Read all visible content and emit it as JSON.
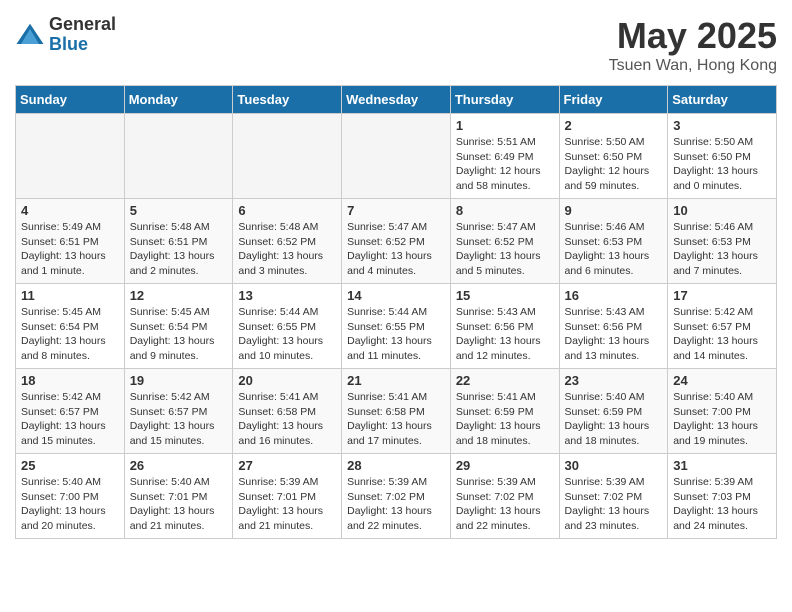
{
  "logo": {
    "general": "General",
    "blue": "Blue"
  },
  "title": {
    "month": "May 2025",
    "location": "Tsuen Wan, Hong Kong"
  },
  "weekdays": [
    "Sunday",
    "Monday",
    "Tuesday",
    "Wednesday",
    "Thursday",
    "Friday",
    "Saturday"
  ],
  "weeks": [
    [
      {
        "day": "",
        "info": ""
      },
      {
        "day": "",
        "info": ""
      },
      {
        "day": "",
        "info": ""
      },
      {
        "day": "",
        "info": ""
      },
      {
        "day": "1",
        "sunrise": "Sunrise: 5:51 AM",
        "sunset": "Sunset: 6:49 PM",
        "daylight": "Daylight: 12 hours and 58 minutes."
      },
      {
        "day": "2",
        "sunrise": "Sunrise: 5:50 AM",
        "sunset": "Sunset: 6:50 PM",
        "daylight": "Daylight: 12 hours and 59 minutes."
      },
      {
        "day": "3",
        "sunrise": "Sunrise: 5:50 AM",
        "sunset": "Sunset: 6:50 PM",
        "daylight": "Daylight: 13 hours and 0 minutes."
      }
    ],
    [
      {
        "day": "4",
        "sunrise": "Sunrise: 5:49 AM",
        "sunset": "Sunset: 6:51 PM",
        "daylight": "Daylight: 13 hours and 1 minute."
      },
      {
        "day": "5",
        "sunrise": "Sunrise: 5:48 AM",
        "sunset": "Sunset: 6:51 PM",
        "daylight": "Daylight: 13 hours and 2 minutes."
      },
      {
        "day": "6",
        "sunrise": "Sunrise: 5:48 AM",
        "sunset": "Sunset: 6:52 PM",
        "daylight": "Daylight: 13 hours and 3 minutes."
      },
      {
        "day": "7",
        "sunrise": "Sunrise: 5:47 AM",
        "sunset": "Sunset: 6:52 PM",
        "daylight": "Daylight: 13 hours and 4 minutes."
      },
      {
        "day": "8",
        "sunrise": "Sunrise: 5:47 AM",
        "sunset": "Sunset: 6:52 PM",
        "daylight": "Daylight: 13 hours and 5 minutes."
      },
      {
        "day": "9",
        "sunrise": "Sunrise: 5:46 AM",
        "sunset": "Sunset: 6:53 PM",
        "daylight": "Daylight: 13 hours and 6 minutes."
      },
      {
        "day": "10",
        "sunrise": "Sunrise: 5:46 AM",
        "sunset": "Sunset: 6:53 PM",
        "daylight": "Daylight: 13 hours and 7 minutes."
      }
    ],
    [
      {
        "day": "11",
        "sunrise": "Sunrise: 5:45 AM",
        "sunset": "Sunset: 6:54 PM",
        "daylight": "Daylight: 13 hours and 8 minutes."
      },
      {
        "day": "12",
        "sunrise": "Sunrise: 5:45 AM",
        "sunset": "Sunset: 6:54 PM",
        "daylight": "Daylight: 13 hours and 9 minutes."
      },
      {
        "day": "13",
        "sunrise": "Sunrise: 5:44 AM",
        "sunset": "Sunset: 6:55 PM",
        "daylight": "Daylight: 13 hours and 10 minutes."
      },
      {
        "day": "14",
        "sunrise": "Sunrise: 5:44 AM",
        "sunset": "Sunset: 6:55 PM",
        "daylight": "Daylight: 13 hours and 11 minutes."
      },
      {
        "day": "15",
        "sunrise": "Sunrise: 5:43 AM",
        "sunset": "Sunset: 6:56 PM",
        "daylight": "Daylight: 13 hours and 12 minutes."
      },
      {
        "day": "16",
        "sunrise": "Sunrise: 5:43 AM",
        "sunset": "Sunset: 6:56 PM",
        "daylight": "Daylight: 13 hours and 13 minutes."
      },
      {
        "day": "17",
        "sunrise": "Sunrise: 5:42 AM",
        "sunset": "Sunset: 6:57 PM",
        "daylight": "Daylight: 13 hours and 14 minutes."
      }
    ],
    [
      {
        "day": "18",
        "sunrise": "Sunrise: 5:42 AM",
        "sunset": "Sunset: 6:57 PM",
        "daylight": "Daylight: 13 hours and 15 minutes."
      },
      {
        "day": "19",
        "sunrise": "Sunrise: 5:42 AM",
        "sunset": "Sunset: 6:57 PM",
        "daylight": "Daylight: 13 hours and 15 minutes."
      },
      {
        "day": "20",
        "sunrise": "Sunrise: 5:41 AM",
        "sunset": "Sunset: 6:58 PM",
        "daylight": "Daylight: 13 hours and 16 minutes."
      },
      {
        "day": "21",
        "sunrise": "Sunrise: 5:41 AM",
        "sunset": "Sunset: 6:58 PM",
        "daylight": "Daylight: 13 hours and 17 minutes."
      },
      {
        "day": "22",
        "sunrise": "Sunrise: 5:41 AM",
        "sunset": "Sunset: 6:59 PM",
        "daylight": "Daylight: 13 hours and 18 minutes."
      },
      {
        "day": "23",
        "sunrise": "Sunrise: 5:40 AM",
        "sunset": "Sunset: 6:59 PM",
        "daylight": "Daylight: 13 hours and 18 minutes."
      },
      {
        "day": "24",
        "sunrise": "Sunrise: 5:40 AM",
        "sunset": "Sunset: 7:00 PM",
        "daylight": "Daylight: 13 hours and 19 minutes."
      }
    ],
    [
      {
        "day": "25",
        "sunrise": "Sunrise: 5:40 AM",
        "sunset": "Sunset: 7:00 PM",
        "daylight": "Daylight: 13 hours and 20 minutes."
      },
      {
        "day": "26",
        "sunrise": "Sunrise: 5:40 AM",
        "sunset": "Sunset: 7:01 PM",
        "daylight": "Daylight: 13 hours and 21 minutes."
      },
      {
        "day": "27",
        "sunrise": "Sunrise: 5:39 AM",
        "sunset": "Sunset: 7:01 PM",
        "daylight": "Daylight: 13 hours and 21 minutes."
      },
      {
        "day": "28",
        "sunrise": "Sunrise: 5:39 AM",
        "sunset": "Sunset: 7:02 PM",
        "daylight": "Daylight: 13 hours and 22 minutes."
      },
      {
        "day": "29",
        "sunrise": "Sunrise: 5:39 AM",
        "sunset": "Sunset: 7:02 PM",
        "daylight": "Daylight: 13 hours and 22 minutes."
      },
      {
        "day": "30",
        "sunrise": "Sunrise: 5:39 AM",
        "sunset": "Sunset: 7:02 PM",
        "daylight": "Daylight: 13 hours and 23 minutes."
      },
      {
        "day": "31",
        "sunrise": "Sunrise: 5:39 AM",
        "sunset": "Sunset: 7:03 PM",
        "daylight": "Daylight: 13 hours and 24 minutes."
      }
    ]
  ]
}
